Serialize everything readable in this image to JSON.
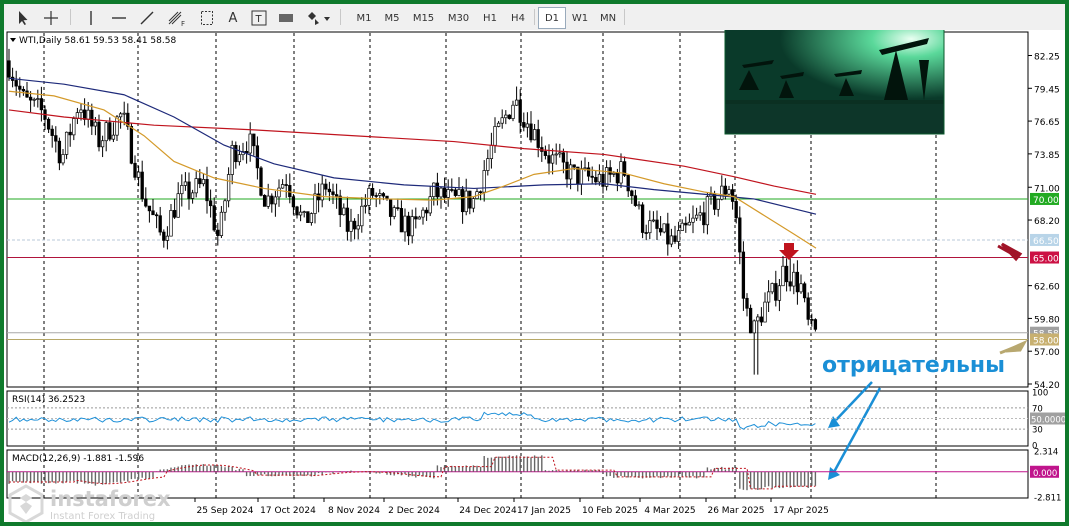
{
  "toolbar": {
    "tools": [
      {
        "name": "cursor-icon"
      },
      {
        "name": "crosshair-icon"
      },
      {
        "name": "vertical-line-icon"
      },
      {
        "name": "horizontal-line-icon"
      },
      {
        "name": "trendline-icon"
      },
      {
        "name": "fibonacci-icon",
        "label": "F"
      },
      {
        "name": "text-box-icon"
      },
      {
        "name": "text-tool-icon",
        "label": "A"
      },
      {
        "name": "text-label-icon",
        "label": "T"
      },
      {
        "name": "rectangle-icon"
      },
      {
        "name": "shapes-icon"
      }
    ],
    "timeframes": [
      "M1",
      "M5",
      "M15",
      "M30",
      "H1",
      "H4",
      "D1",
      "W1",
      "MN"
    ],
    "active_timeframe": "D1"
  },
  "chart": {
    "header": "WTI,Daily  58.61 59.53 58.41 58.58",
    "y_ticks": [
      "82.25",
      "79.45",
      "76.65",
      "73.85",
      "71.00",
      "68.20",
      "62.60",
      "59.80",
      "57.00",
      "54.20"
    ],
    "x_labels": [
      "25 Sep 2024",
      "17 Oct 2024",
      "8 Nov 2024",
      "2 Dec 2024",
      "24 Dec 2024",
      "17 Jan 2025",
      "10 Feb 2025",
      "4 Mar 2025",
      "26 Mar 2025",
      "17 Apr 2025"
    ],
    "price_tags": [
      {
        "text": "70.00",
        "bg": "#22aa22"
      },
      {
        "text": "66.50",
        "bg": "#b8d4e8"
      },
      {
        "text": "65.00",
        "bg": "#cc1144"
      },
      {
        "text": "58.58",
        "bg": "#a0a0a0"
      },
      {
        "text": "58.00",
        "bg": "#c8b070"
      }
    ],
    "annotation": "отрицательны",
    "annotation_color": "#1a8fd6",
    "rsi": {
      "header": "RSI(14) 36.2523",
      "ticks": [
        "100",
        "70",
        "50.0000",
        "30",
        "0"
      ]
    },
    "macd": {
      "header": "MACD(12,26,9) -1.881 -1.596",
      "ticks": [
        "2.314",
        "0.000",
        "-2.811"
      ]
    },
    "colors": {
      "ma_red": "#c0141e",
      "ma_blue": "#1e2a7a",
      "ma_orange": "#d49a2a",
      "level_green": "#22aa22",
      "level_red": "#b0143c",
      "level_olive": "#b6a868"
    }
  },
  "watermark": {
    "brand": "instaforex",
    "tagline": "Instant Forex Trading"
  }
}
